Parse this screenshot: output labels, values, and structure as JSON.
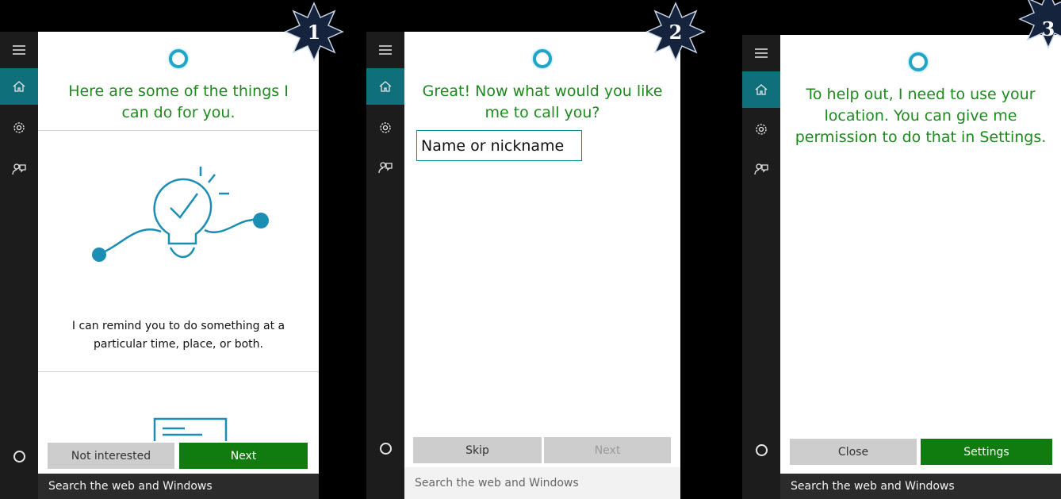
{
  "panels": [
    {
      "step": "1",
      "title": "Here are some of the things I can do for you.",
      "body": "I can remind you to do something at a particular time, place, or both.",
      "buttons": {
        "left": "Not interested",
        "right": "Next"
      },
      "search": "Search the web and Windows"
    },
    {
      "step": "2",
      "title": "Great! Now what would you like me to call you?",
      "input_placeholder": "Name or nickname",
      "buttons": {
        "left": "Skip",
        "right": "Next"
      },
      "search": "Search the web and Windows"
    },
    {
      "step": "3",
      "title": "To help out, I need to use your location. You can give me permission to do that in Settings.",
      "buttons": {
        "left": "Close",
        "right": "Settings"
      },
      "search": "Search the web and Windows"
    }
  ],
  "colors": {
    "accent_green": "#107c10",
    "title_green": "#1d8a1d",
    "teal_active": "#0f6f7a",
    "cortana_blue": "#1ea5c8",
    "badge_navy": "#15233d"
  },
  "icons": {
    "sidebar": [
      "hamburger-icon",
      "home-icon",
      "settings-gear-icon",
      "feedback-icon",
      "cortana-icon"
    ],
    "illustration": "lightbulb-reminder-icon"
  }
}
